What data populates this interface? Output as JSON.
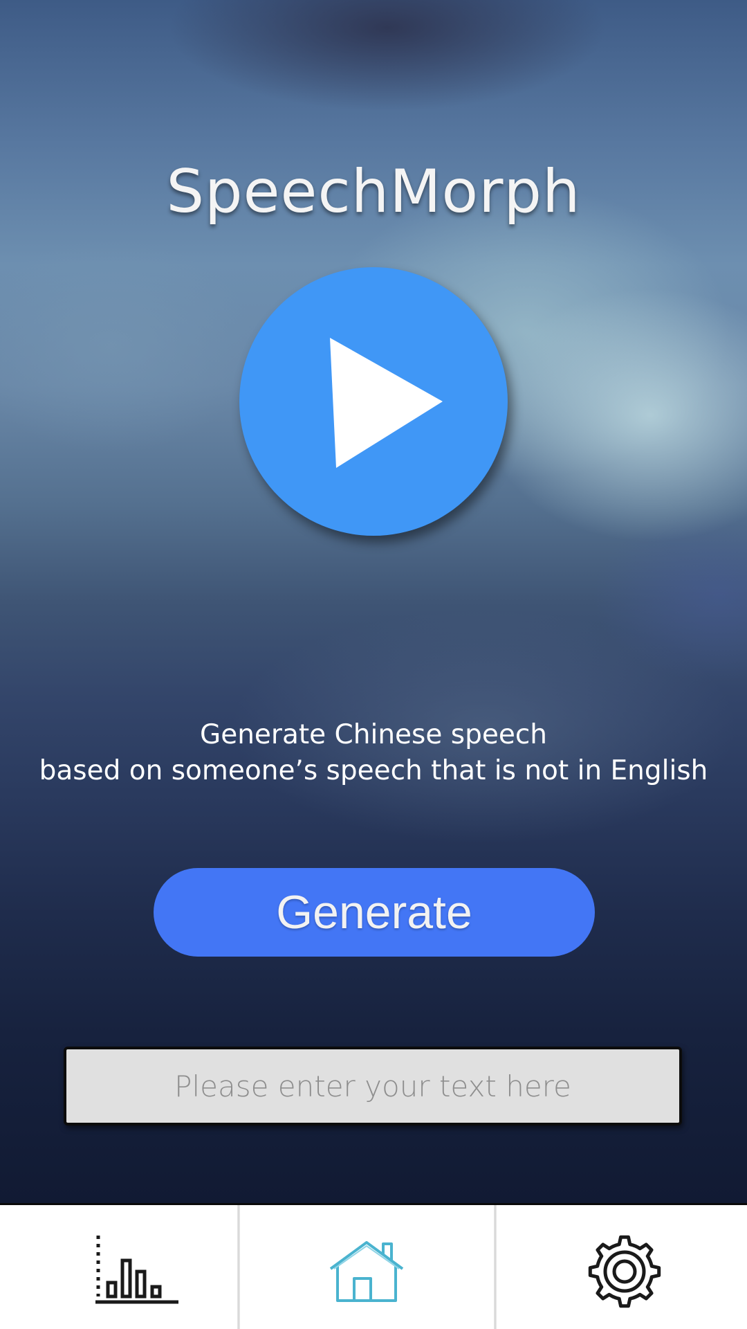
{
  "app": {
    "title": "SpeechMorph"
  },
  "player": {
    "play_icon": "play-icon",
    "accent_color": "#4097f6"
  },
  "description": {
    "line1": "Generate Chinese speech",
    "line2": "based on someone’s speech that is not in English"
  },
  "generate": {
    "label": "Generate",
    "color": "#4376f5"
  },
  "text_input": {
    "value": "",
    "placeholder": "Please enter your text here"
  },
  "nav": {
    "items": [
      {
        "id": "stats",
        "icon": "bar-chart-icon",
        "active": false
      },
      {
        "id": "home",
        "icon": "home-icon",
        "active": true
      },
      {
        "id": "settings",
        "icon": "gear-icon",
        "active": false
      }
    ],
    "active_color": "#4ab3cf",
    "inactive_color": "#1a1a1a"
  }
}
